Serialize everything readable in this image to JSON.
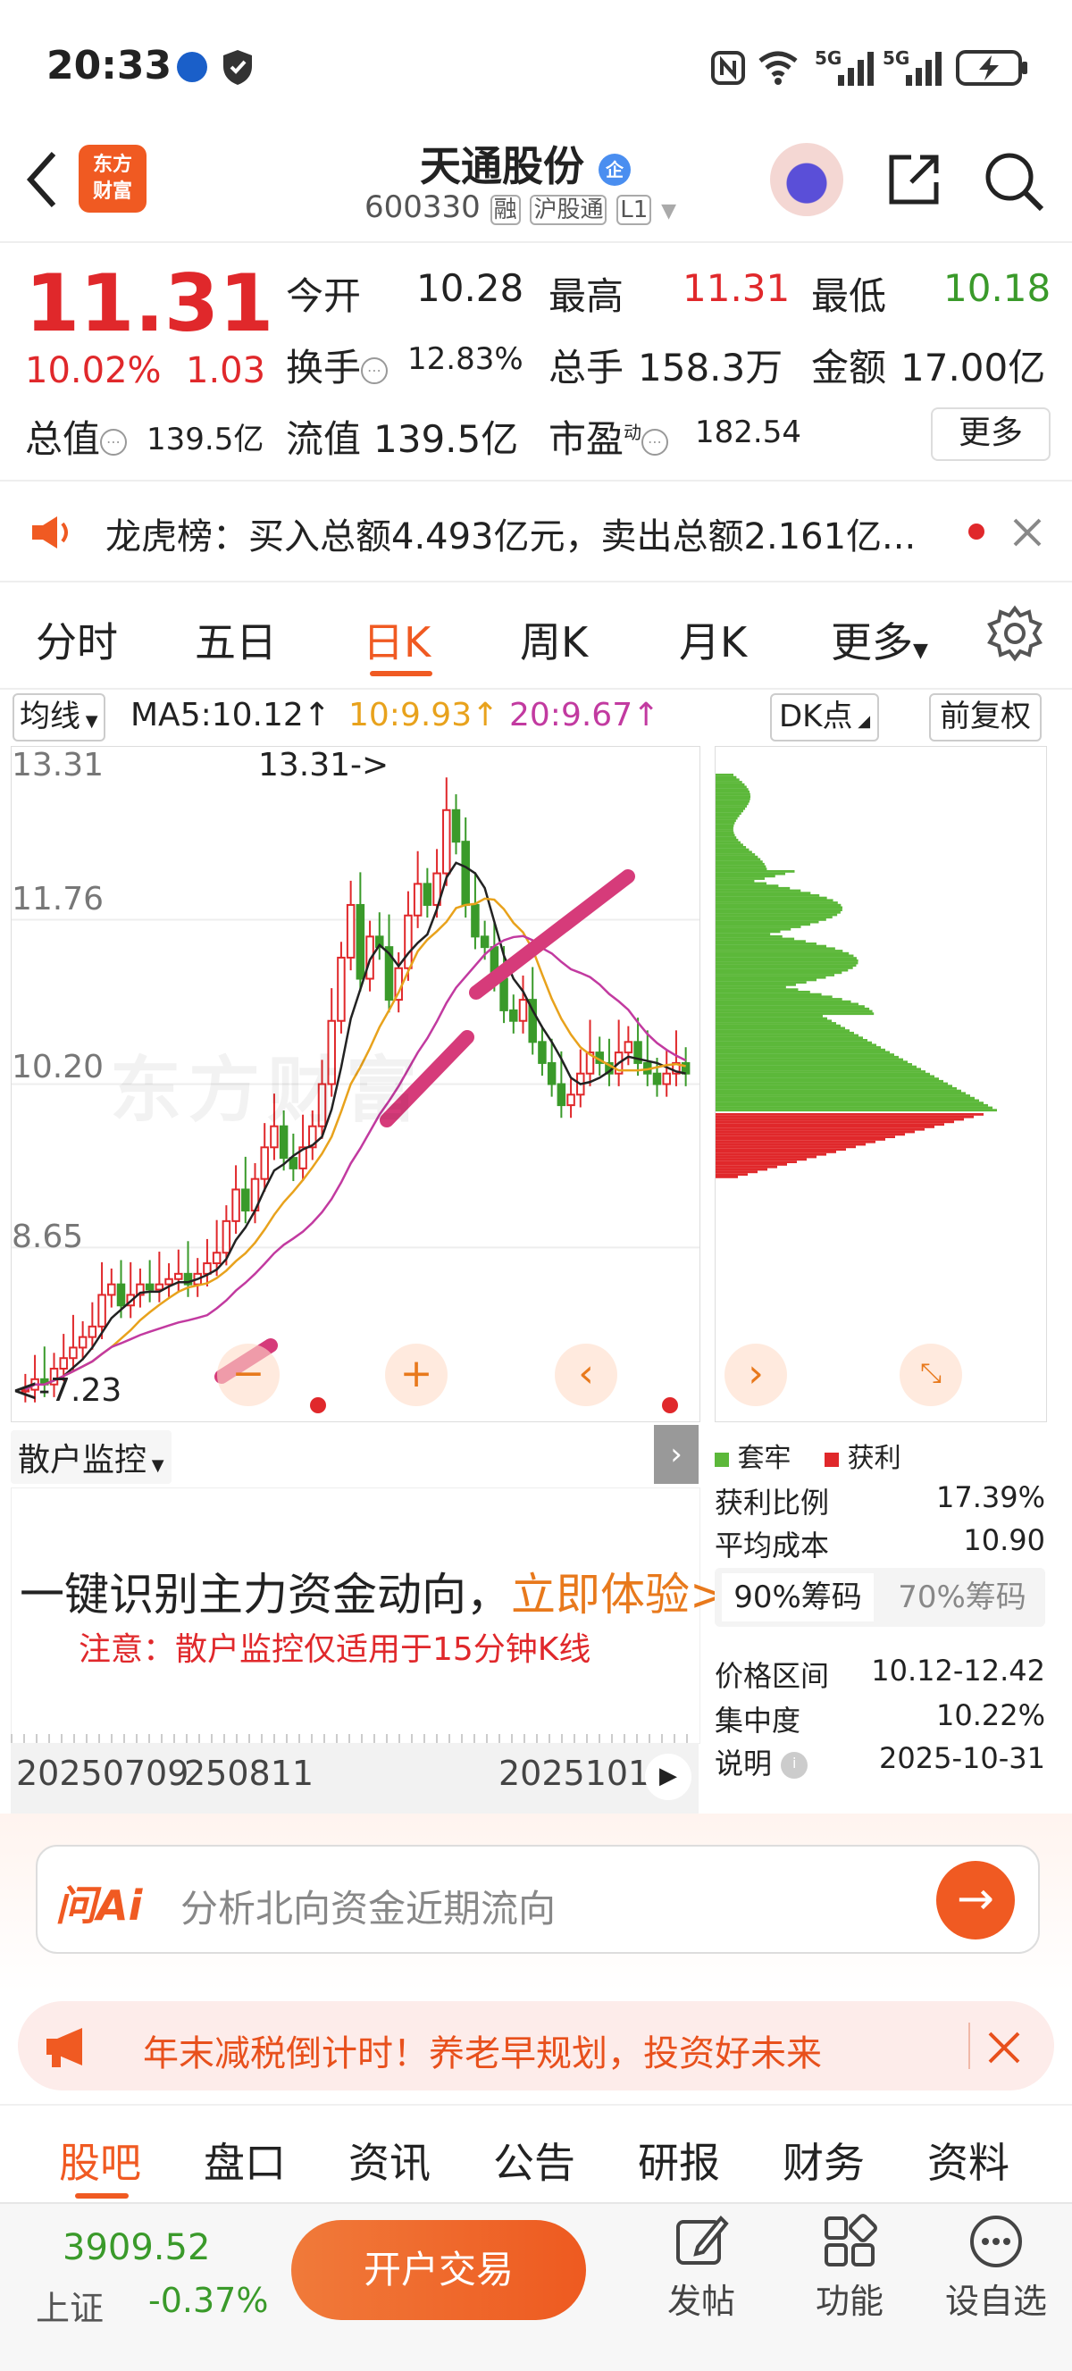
{
  "status": {
    "time": "20:33"
  },
  "header": {
    "title": "天通股份",
    "title_badge": "企",
    "code": "600330",
    "tags": [
      "融",
      "沪股通",
      "L1"
    ],
    "logo_line1": "东方",
    "logo_line2": "财富"
  },
  "quote": {
    "price": "11.31",
    "pct": "10.02%",
    "change": "1.03",
    "open_label": "今开",
    "open": "10.28",
    "high_label": "最高",
    "high": "11.31",
    "low_label": "最低",
    "low": "10.18",
    "turnover_label": "换手",
    "turnover": "12.83%",
    "volume_label": "总手",
    "volume": "158.3万",
    "amount_label": "金额",
    "amount": "17.00亿",
    "mktcap_label": "总值",
    "mktcap": "139.5亿",
    "float_label": "流值",
    "float": "139.5亿",
    "pe_label": "市盈",
    "pe_sup": "动",
    "pe": "182.54",
    "more_label": "更多"
  },
  "notice": {
    "text": "龙虎榜：买入总额4.493亿元，卖出总额2.161亿..."
  },
  "tabs": [
    {
      "label": "分时"
    },
    {
      "label": "五日"
    },
    {
      "label": "日K"
    },
    {
      "label": "周K"
    },
    {
      "label": "月K"
    },
    {
      "label": "更多"
    }
  ],
  "ma": {
    "select_label": "均线",
    "ma5": "MA5:10.12↑",
    "ma10": "10:9.93↑",
    "ma20": "20:9.67↑",
    "dk_label": "DK点",
    "adjust_label": "前复权"
  },
  "chart_data": {
    "type": "candlestick",
    "y_ticks": [
      "13.31",
      "11.76",
      "10.20",
      "8.65"
    ],
    "high_marker": "13.31->",
    "low_marker": "<-7.23",
    "watermark": "东方财富",
    "colors": {
      "up": "#e0282b",
      "down": "#3a9a2a",
      "ma5": "#222222",
      "ma10": "#e8a21c",
      "ma20": "#c23aa0"
    }
  },
  "retail": {
    "title": "散户监控",
    "headline": "一键识别主力资金动向，",
    "cta": "立即体验>",
    "note": "注意：散户监控仅适用于15分钟K线",
    "date1": "20250709",
    "date2": "250811",
    "date3": "2025101"
  },
  "chips": {
    "legend_trap": "套牢",
    "legend_profit": "获利",
    "profit_ratio_label": "获利比例",
    "profit_ratio": "17.39%",
    "avg_cost_label": "平均成本",
    "avg_cost": "10.90",
    "tab90": "90%筹码",
    "tab70": "70%筹码",
    "range_label": "价格区间",
    "range": "10.12-12.42",
    "conc_label": "集中度",
    "conc": "10.22%",
    "desc_label": "说明",
    "desc_date": "2025-10-31"
  },
  "ai": {
    "brand": "问Ai",
    "placeholder": "分析北向资金近期流向"
  },
  "promo": {
    "text": "年末减税倒计时！养老早规划，投资好未来"
  },
  "nav": [
    {
      "label": "股吧"
    },
    {
      "label": "盘口"
    },
    {
      "label": "资讯"
    },
    {
      "label": "公告"
    },
    {
      "label": "研报"
    },
    {
      "label": "财务"
    },
    {
      "label": "资料"
    }
  ],
  "bottom": {
    "index_value": "3909.52",
    "index_name": "上证",
    "index_change": "-0.37%",
    "trade_label": "开户交易",
    "post_label": "发帖",
    "func_label": "功能",
    "watch_label": "设自选"
  }
}
